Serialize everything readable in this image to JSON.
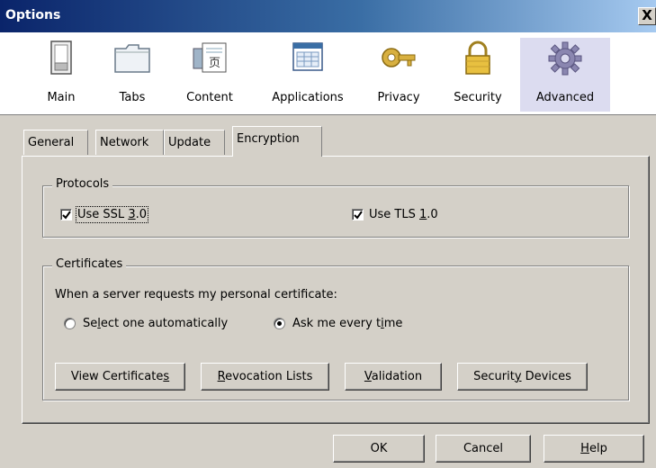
{
  "window": {
    "title": "Options",
    "close_label": "X"
  },
  "toolbar": {
    "items": [
      {
        "label": "Main",
        "icon": "main-switch-icon"
      },
      {
        "label": "Tabs",
        "icon": "tabs-folder-icon"
      },
      {
        "label": "Content",
        "icon": "content-page-icon"
      },
      {
        "label": "Applications",
        "icon": "applications-window-icon"
      },
      {
        "label": "Privacy",
        "icon": "privacy-key-icon"
      },
      {
        "label": "Security",
        "icon": "security-lock-icon"
      },
      {
        "label": "Advanced",
        "icon": "advanced-gear-icon",
        "selected": true
      }
    ]
  },
  "tabs": [
    {
      "label": "General"
    },
    {
      "label": "Network"
    },
    {
      "label": "Update"
    },
    {
      "label": "Encryption",
      "active": true
    }
  ],
  "protocols": {
    "legend": "Protocols",
    "ssl": {
      "pre": "Use SSL ",
      "accel": "3",
      "post": ".0",
      "checked": true
    },
    "tls": {
      "pre": "Use TLS ",
      "accel": "1",
      "post": ".0",
      "checked": true
    }
  },
  "certificates": {
    "legend": "Certificates",
    "prompt": "When a server requests my personal certificate:",
    "radio_auto": {
      "pre": "Se",
      "accel": "l",
      "post": "ect one automatically",
      "selected": false
    },
    "radio_ask": {
      "pre": "Ask me every t",
      "accel": "i",
      "post": "me",
      "selected": true
    },
    "buttons": {
      "view": {
        "pre": "View Certificate",
        "accel": "s",
        "post": ""
      },
      "revocation": {
        "pre": "",
        "accel": "R",
        "post": "evocation Lists"
      },
      "validation": {
        "pre": "",
        "accel": "V",
        "post": "alidation"
      },
      "devices": {
        "pre": "Securit",
        "accel": "y",
        "post": " Devices"
      }
    }
  },
  "footer": {
    "ok": "OK",
    "cancel": "Cancel",
    "help": {
      "pre": "",
      "accel": "H",
      "post": "elp"
    }
  }
}
